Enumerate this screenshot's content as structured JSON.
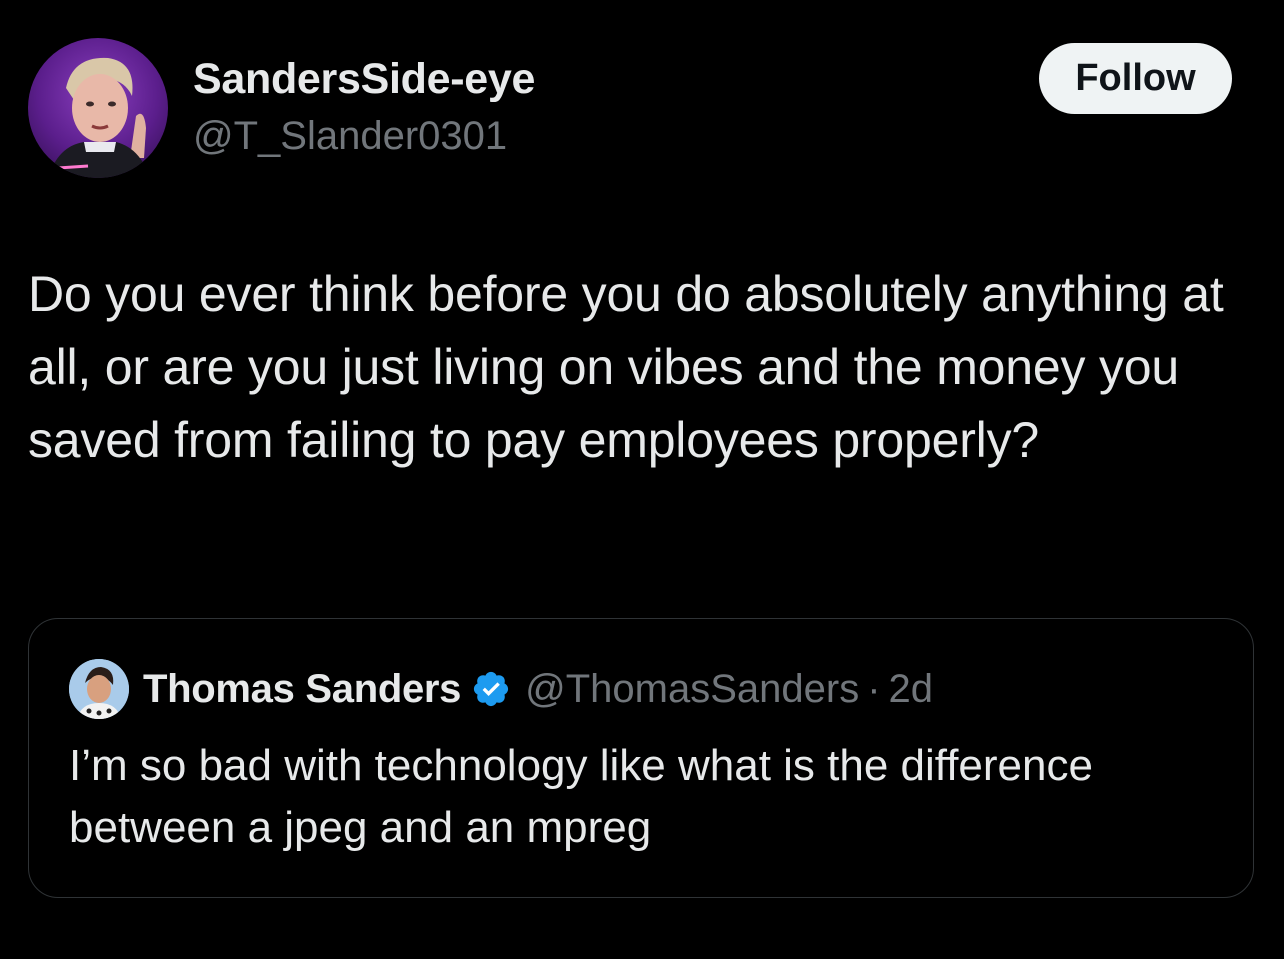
{
  "tweet": {
    "author": {
      "display_name": "SandersSide-eye",
      "handle": "@T_Slander0301",
      "avatar_icon": "profile-avatar-icon"
    },
    "follow_label": "Follow",
    "text": "Do you ever think before you do absolutely anything at all, or are you just living on vibes and the money you saved from failing to pay employees properly?"
  },
  "quote": {
    "author": {
      "display_name": "Thomas Sanders",
      "verified_icon": "verified-badge-icon",
      "handle": "@ThomasSanders",
      "separator": "·",
      "time": "2d"
    },
    "text": "I’m so bad with technology like what is the difference between a jpeg and an mpreg"
  },
  "colors": {
    "background": "#000000",
    "primary_text": "#e7e9ea",
    "secondary_text": "#71767b",
    "border": "#2f3336",
    "follow_button_bg": "#eff3f4",
    "verified_blue": "#1d9bf0"
  }
}
